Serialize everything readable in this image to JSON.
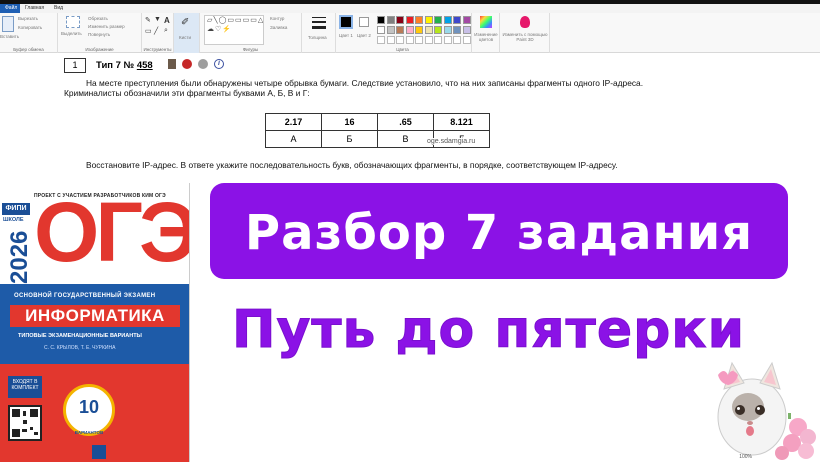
{
  "ribbon": {
    "tabs": {
      "file": "Файл",
      "home": "Главная",
      "view": "Вид"
    },
    "clipboard": {
      "paste": "Вставить",
      "cut": "Вырезать",
      "copy": "Копировать",
      "label": "Буфер обмена"
    },
    "image": {
      "select": "Выделить",
      "crop": "Обрезать",
      "resize": "Изменить размер",
      "rotate": "Повернуть",
      "label": "Изображение"
    },
    "tools": {
      "label": "Инструменты"
    },
    "brushes": {
      "label": "Кисти"
    },
    "shapes": {
      "glyphs": "▱╲◯▭▭▭▭△▷◇⬠⬡⇨⇦⇧⇩✦✧☆✩◠☁♡⚡",
      "outline": "Контур",
      "fill": "Заливка",
      "label": "Фигуры"
    },
    "size": {
      "label": "Толщина"
    },
    "color1": {
      "label": "Цвет 1"
    },
    "color2": {
      "label": "Цвет 2"
    },
    "colors": {
      "label": "Цвета",
      "palette": [
        "#000000",
        "#7f7f7f",
        "#880015",
        "#ed1c24",
        "#ff7f27",
        "#fff200",
        "#22b14c",
        "#00a2e8",
        "#3f48cc",
        "#a349a4",
        "#ffffff",
        "#c3c3c3",
        "#b97a57",
        "#ffaec9",
        "#ffc90e",
        "#efe4b0",
        "#b5e61d",
        "#99d9ea",
        "#7092be",
        "#c8bfe7"
      ]
    },
    "edit_colors": "Изменение цветов",
    "paint3d": "Изменить с помощью Paint 3D"
  },
  "problem": {
    "number": "1",
    "type_prefix": "Тип 7 № ",
    "type_id": "458",
    "text1": "На месте преступления были обнаружены четыре обрывка бумаги. Следствие установило, что на них записаны фрагменты одного IP-адреса. Криминалисты обозначили эти фрагменты буквами А, Б, В и Г:",
    "fragments": [
      "2.17",
      "16",
      ".65",
      "8.121"
    ],
    "letters": [
      "А",
      "Б",
      "В",
      "Г"
    ],
    "watermark": "oge.sdamgia.ru",
    "text2": "Восстановите IP-адрес. В ответе укажите последовательность букв, обозначающих фрагменты, в порядке, соответствующем IP-адресу."
  },
  "book": {
    "fipi": "ФИПИ",
    "school": "ШКОЛЕ",
    "year": "2026",
    "project": "ПРОЕКТ С УЧАСТИЕМ РАЗРАБОТЧИКОВ КИМ ОГЭ",
    "oge": "ОГЭ",
    "exam": "ОСНОВНОЙ ГОСУДАРСТВЕННЫЙ ЭКЗАМЕН",
    "subject": "ИНФОРМАТИКА",
    "typical": "ТИПОВЫЕ ЭКЗАМЕНАЦИОННЫЕ ВАРИАНТЫ",
    "authors": "С. С. КРЫЛОВ, Т. Е. ЧУРКИНА",
    "variants_count": "10",
    "variants_word": "ВАРИАНТОВ",
    "qr_label": "ВХОДЯТ В КОМПЛЕКТ"
  },
  "banner": {
    "title": "Разбор 7 задания",
    "subtitle": "Путь до пятерки"
  },
  "status": {
    "zoom": "100%"
  }
}
